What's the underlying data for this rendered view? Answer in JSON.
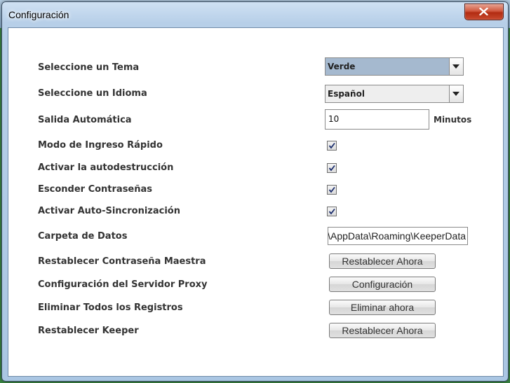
{
  "window": {
    "title": "Configuración"
  },
  "settings": {
    "theme": {
      "label": "Seleccione un Tema",
      "value": "Verde"
    },
    "language": {
      "label": "Seleccione un Idioma",
      "value": "Español"
    },
    "auto_logout": {
      "label": "Salida Automática",
      "value": "10",
      "unit": "Minutos"
    },
    "quick_login": {
      "label": "Modo de Ingreso Rápido",
      "checked": true
    },
    "self_destruct": {
      "label": "Activar la autodestrucción",
      "checked": true
    },
    "hide_passwords": {
      "label": "Esconder Contraseñas",
      "checked": true
    },
    "auto_sync": {
      "label": "Activar Auto-Sincronización",
      "checked": true
    },
    "data_folder": {
      "label": "Carpeta de Datos",
      "value": "\\AppData\\Roaming\\KeeperData"
    },
    "reset_master": {
      "label": "Restablecer Contraseña Maestra",
      "button": "Restablecer Ahora"
    },
    "proxy": {
      "label": "Configuración del Servidor Proxy",
      "button": "Configuración"
    },
    "delete_records": {
      "label": "Eliminar Todos los Registros",
      "button": "Eliminar ahora"
    },
    "reset_keeper": {
      "label": "Restablecer Keeper",
      "button": "Restablecer Ahora"
    }
  },
  "colors": {
    "selected_combo": "#a5b9cf",
    "close_button": "#c94a2e",
    "title_bar": "#b7cfe8"
  },
  "icons": {
    "close": "close-icon",
    "check": "check-icon",
    "dropdown": "chevron-down-icon"
  }
}
